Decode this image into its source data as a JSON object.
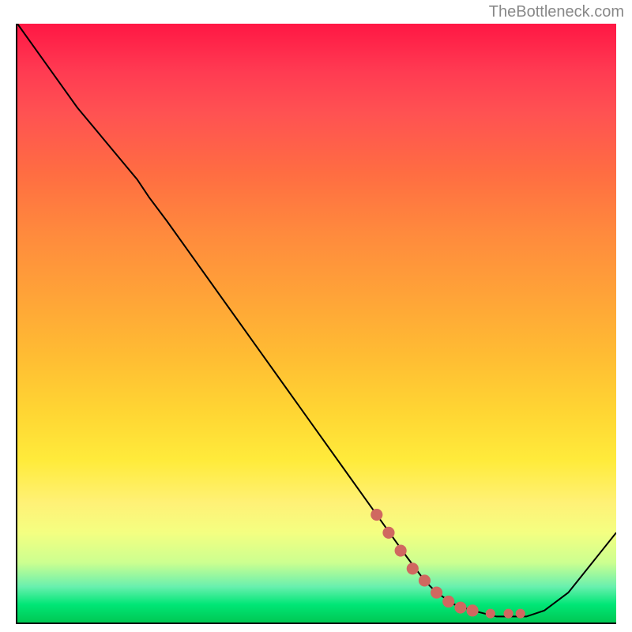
{
  "attribution": "TheBottleneck.com",
  "chart_data": {
    "type": "line",
    "title": "",
    "xlabel": "",
    "ylabel": "",
    "xlim": [
      0,
      100
    ],
    "ylim": [
      0,
      100
    ],
    "series": [
      {
        "name": "bottleneck-curve",
        "x": [
          0,
          5,
          10,
          15,
          20,
          22,
          25,
          30,
          35,
          40,
          45,
          50,
          55,
          60,
          65,
          68,
          70,
          73,
          76,
          80,
          83,
          85,
          88,
          92,
          96,
          100
        ],
        "y": [
          100,
          93,
          86,
          80,
          74,
          71,
          67,
          60,
          53,
          46,
          39,
          32,
          25,
          18,
          11,
          7,
          5,
          3,
          2,
          1,
          1,
          1,
          2,
          5,
          10,
          15
        ]
      }
    ],
    "markers": {
      "name": "highlighted-range",
      "color": "#d06860",
      "points": [
        {
          "x": 60,
          "y": 18
        },
        {
          "x": 62,
          "y": 15
        },
        {
          "x": 64,
          "y": 12
        },
        {
          "x": 66,
          "y": 9
        },
        {
          "x": 68,
          "y": 7
        },
        {
          "x": 70,
          "y": 5
        },
        {
          "x": 72,
          "y": 3.5
        },
        {
          "x": 74,
          "y": 2.5
        },
        {
          "x": 76,
          "y": 2
        },
        {
          "x": 79,
          "y": 1.5
        },
        {
          "x": 82,
          "y": 1.5
        },
        {
          "x": 84,
          "y": 1.5
        }
      ]
    },
    "gradient_colors": {
      "top": "#ff1744",
      "middle": "#ffd633",
      "bottom": "#00c853"
    }
  }
}
